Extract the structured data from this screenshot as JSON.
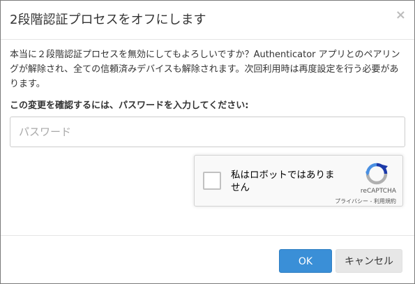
{
  "dialog": {
    "title": "2段階認証プロセスをオフにします",
    "close_label": "×",
    "message": "本当に２段階認証プロセスを無効にしてもよろしいですか？Authenticator アプリとのペアリングが解除され、全ての信頼済みデバイスも解除されます。次回利用時は再度設定を行う必要があります。",
    "confirm_label": "この変更を確認するには、パスワードを入力してください:",
    "password": {
      "value": "",
      "placeholder": "パスワード"
    }
  },
  "recaptcha": {
    "label": "私はロボットではありません",
    "brand": "reCAPTCHA",
    "privacy_link": "プライバシー",
    "separator": " - ",
    "terms_link": "利用規約",
    "logo_icon": "recaptcha-logo-icon",
    "colors": {
      "blue": "#1c3aa9",
      "light_blue": "#4a90e2",
      "gray": "#b0b0b0"
    }
  },
  "footer": {
    "ok_label": "OK",
    "cancel_label": "キャンセル"
  },
  "colors": {
    "primary": "#3a8fd7",
    "secondary": "#e7e7e7"
  }
}
